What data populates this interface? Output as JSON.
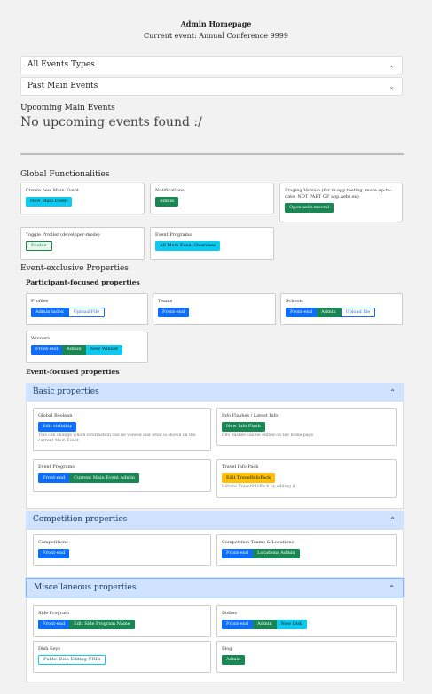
{
  "header": {
    "title": "Admin Homepage",
    "current_event": "Current event: Annual Conference 9999"
  },
  "filters": [
    {
      "label": "All Events Types"
    },
    {
      "label": "Past Main Events"
    }
  ],
  "upcoming": {
    "heading": "Upcoming Main Events",
    "empty_text": "No upcoming events found :/"
  },
  "global": {
    "heading": "Global Functionalities",
    "cards": [
      {
        "label": "Create new Main Event",
        "buttons": [
          "New Main Event"
        ]
      },
      {
        "label": "Notifications",
        "buttons": [
          "Admin"
        ]
      },
      {
        "label": "Staging Version (for in-app testing, more up-to-date, NOT PART OF app.aebt.eu)",
        "buttons": [
          "Open aebt.mocrxl"
        ]
      },
      {
        "label": "Toggle Profiler (developer-mode)",
        "buttons": [
          "Enable"
        ]
      },
      {
        "label": "Event Programs",
        "buttons": [
          "All Main Event Overview"
        ]
      }
    ]
  },
  "event_exclusive": {
    "heading": "Event-exclusive Properties",
    "participant": {
      "heading": "Participant-focused properties",
      "cards": [
        {
          "label": "Profiles",
          "buttons": [
            "Admin index",
            "Upload File"
          ]
        },
        {
          "label": "Teams",
          "buttons": [
            "Front-end"
          ]
        },
        {
          "label": "Schools",
          "buttons": [
            "Front-end",
            "Admin",
            "Upload file"
          ]
        },
        {
          "label": "Winners",
          "buttons": [
            "Front-end",
            "Admin",
            "New Winner"
          ]
        }
      ]
    },
    "event_focused": {
      "heading": "Event-focused properties"
    }
  },
  "basic": {
    "title": "Basic properties",
    "cards": [
      {
        "label": "Global Boolean",
        "buttons": [
          "Edit visibility"
        ],
        "desc": "This can change which information can be viewed and what is shown on the current Main Event"
      },
      {
        "label": "Info Flashes / Latest Info",
        "buttons": [
          "New Info Flash"
        ],
        "desc": "Info flashes can be edited on the home page"
      },
      {
        "label": "Event Programs",
        "buttons": [
          "Front-end",
          "Current Main Event Admin"
        ]
      },
      {
        "label": "Travel Info Pack",
        "buttons": [
          "Edit TravelInfoPack"
        ],
        "desc": "Initiate TravelInfoPack by editing it"
      }
    ]
  },
  "competition": {
    "title": "Competition properties",
    "cards": [
      {
        "label": "Competitions",
        "buttons": [
          "Front-end"
        ]
      },
      {
        "label": "Competition Teams & Locations",
        "buttons": [
          "Front-end",
          "Locations Admin"
        ]
      }
    ]
  },
  "misc": {
    "title": "Miscellaneous properties",
    "cards": [
      {
        "label": "Side Program",
        "buttons": [
          "Front-end",
          "Edit Side Program Name"
        ]
      },
      {
        "label": "Dishes",
        "buttons": [
          "Front-end",
          "Admin",
          "New Dish"
        ]
      },
      {
        "label": "Dish Keys",
        "buttons": [
          "Public Dish Editing URLs"
        ]
      },
      {
        "label": "Blog",
        "buttons": [
          "Admin"
        ]
      }
    ]
  },
  "icons": {
    "chevron": "chevron-down-icon",
    "chevron_up": "chevron-up-icon"
  },
  "colors": {
    "primary": "#0d6efd",
    "success": "#198754",
    "info": "#0dcaf0",
    "warning": "#ffc107",
    "accordion_header": "#cfe2ff"
  }
}
